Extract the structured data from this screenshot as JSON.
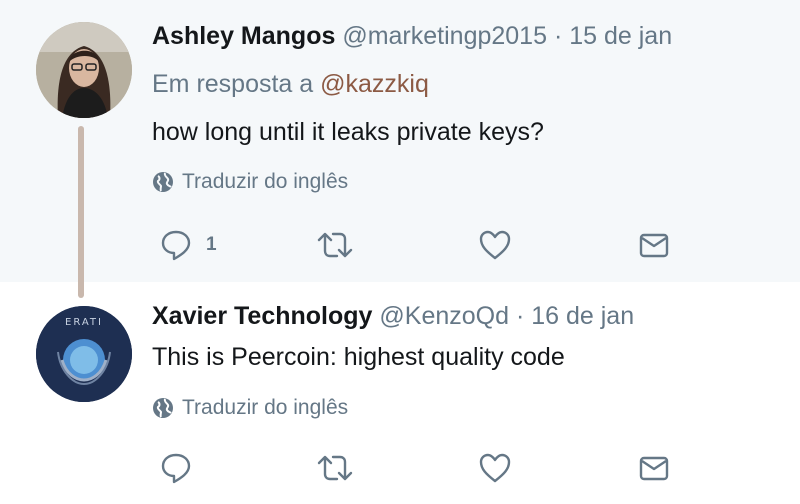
{
  "tweets": [
    {
      "author_name": "Ashley Mangos",
      "handle": "@marketingp2015",
      "separator": "·",
      "date": "15 de jan",
      "reply_prefix": "Em resposta a",
      "reply_mention": "@kazzkiq",
      "text": "how long until it leaks private keys?",
      "translate_label": "Traduzir do inglês",
      "reply_count": "1"
    },
    {
      "author_name": "Xavier Technology",
      "handle": "@KenzoQd",
      "separator": "·",
      "date": "16 de jan",
      "text": "This is Peercoin: highest quality code",
      "translate_label": "Traduzir do inglês",
      "avatar_text": "ERATI"
    }
  ],
  "colors": {
    "text": "#14171a",
    "secondary": "#657786",
    "mention": "#8c5a44",
    "thread_line": "#c9b8ad",
    "highlight_bg": "#f5f8fa"
  },
  "icons": [
    "globe-icon",
    "reply-icon",
    "retweet-icon",
    "like-icon",
    "direct-message-icon"
  ]
}
